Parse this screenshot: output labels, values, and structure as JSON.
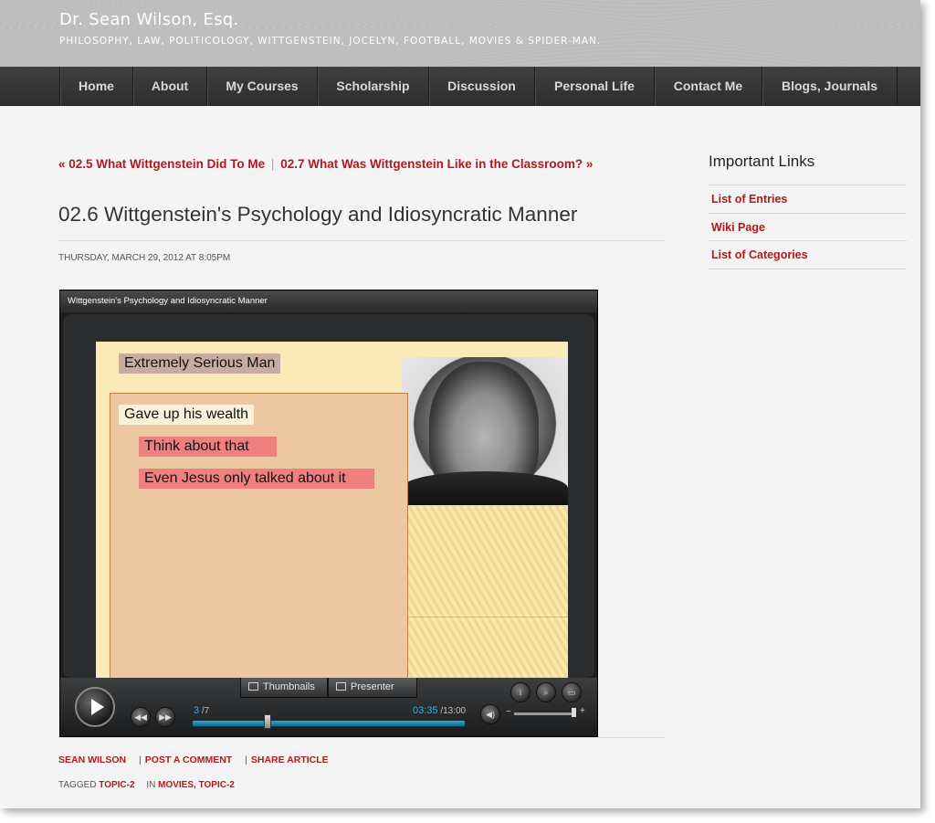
{
  "site": {
    "title": "Dr. Sean Wilson, Esq.",
    "tagline": "PHILOSOPHY, LAW, POLITICOLOGY, WITTGENSTEIN, JOCELYN, FOOTBALL, MOVIES & SPIDER-MAN."
  },
  "nav": [
    "Home",
    "About",
    "My Courses",
    "Scholarship",
    "Discussion",
    "Personal Life",
    "Contact Me",
    "Blogs, Journals"
  ],
  "post_nav": {
    "prev": "« 02.5 What Wittgenstein Did To Me",
    "separator": "|",
    "next": "02.7 What Was Wittgenstein Like in the Classroom? »"
  },
  "post": {
    "title": "02.6 Wittgenstein's Psychology and Idiosyncratic Manner",
    "date": "THURSDAY, MARCH 29, 2012 AT 8:05PM"
  },
  "player": {
    "title": "Wittgenstein's Psychology and Idiosyncratic Manner",
    "slide": {
      "heading": "Extremely Serious Man",
      "items": [
        "Gave up his wealth",
        "Think about that",
        "Even Jesus only talked about it"
      ]
    },
    "tabs": [
      "Thumbnails",
      "Presenter"
    ],
    "slide_current": "3",
    "slide_total": "/7",
    "time_current": "03:35",
    "time_total": "/13:00",
    "progress": 0.275,
    "volume_minus": "−",
    "volume_plus": "+",
    "icons": [
      "play-icon",
      "rewind-icon",
      "fast-forward-icon",
      "info-icon",
      "search-icon",
      "fullscreen-icon",
      "volume-icon"
    ]
  },
  "post_meta": {
    "author": "SEAN WILSON",
    "sep": "|",
    "comment": "POST A COMMENT",
    "share": "SHARE ARTICLE"
  },
  "post_tags": {
    "tagged_label": "TAGGED",
    "tag": "TOPIC-2",
    "in_label": "IN",
    "category1": "MOVIES",
    "comma": ",",
    "category2": "TOPIC-2"
  },
  "sidebar": {
    "title": "Important Links",
    "links": [
      "List of Entries",
      "Wiki Page",
      "List of Categories"
    ]
  },
  "colors": {
    "link_red": "#b0191e",
    "nav_bg": "#333333",
    "header_bg": "#bdbdbd",
    "player_accent": "#38aee0"
  }
}
